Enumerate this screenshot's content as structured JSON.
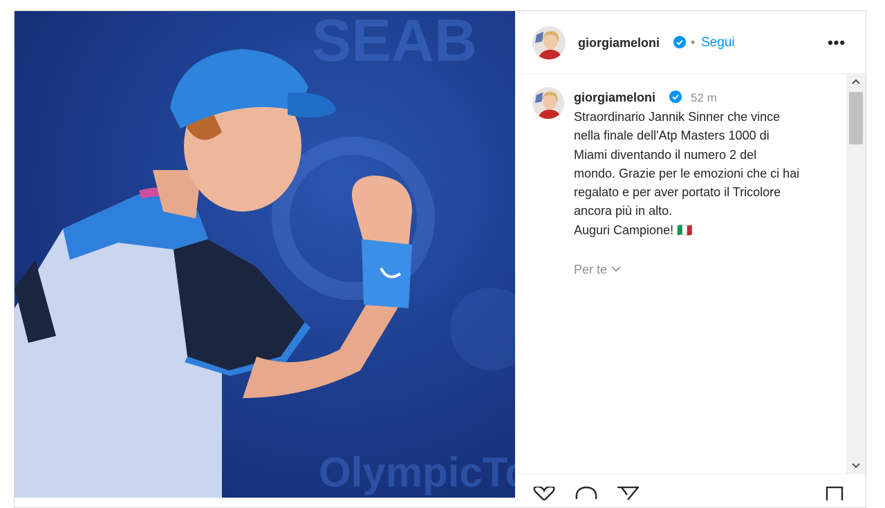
{
  "post": {
    "username": "giorgiameloni",
    "follow_label": "Segui",
    "separator": "•",
    "more_label": "•••",
    "comment": {
      "username": "giorgiameloni",
      "time": "52 m",
      "caption": "Straordinario Jannik Sinner che vince\nnella finale dell'Atp Masters 1000 di\nMiami diventando il numero 2 del\nmondo. Grazie per le emozioni che ci hai\nregalato e per aver portato il Tricolore\nancora più in alto.\nAuguri Campione! 🇮🇹"
    },
    "translation_toggle": "Per te",
    "photo_background_text": {
      "top": "SEAB",
      "bottom": "OlympicTor"
    }
  },
  "colors": {
    "accent": "#0095f6",
    "verified": "#0095f6",
    "text": "#262626",
    "muted": "#8e8e8e",
    "photo_bg": "#1d3e8f"
  },
  "icons": [
    "verified-badge-icon",
    "more-options-icon",
    "chevron-down-icon",
    "scroll-up-icon",
    "scroll-down-icon",
    "heart-icon",
    "comment-icon",
    "share-icon",
    "bookmark-icon"
  ]
}
